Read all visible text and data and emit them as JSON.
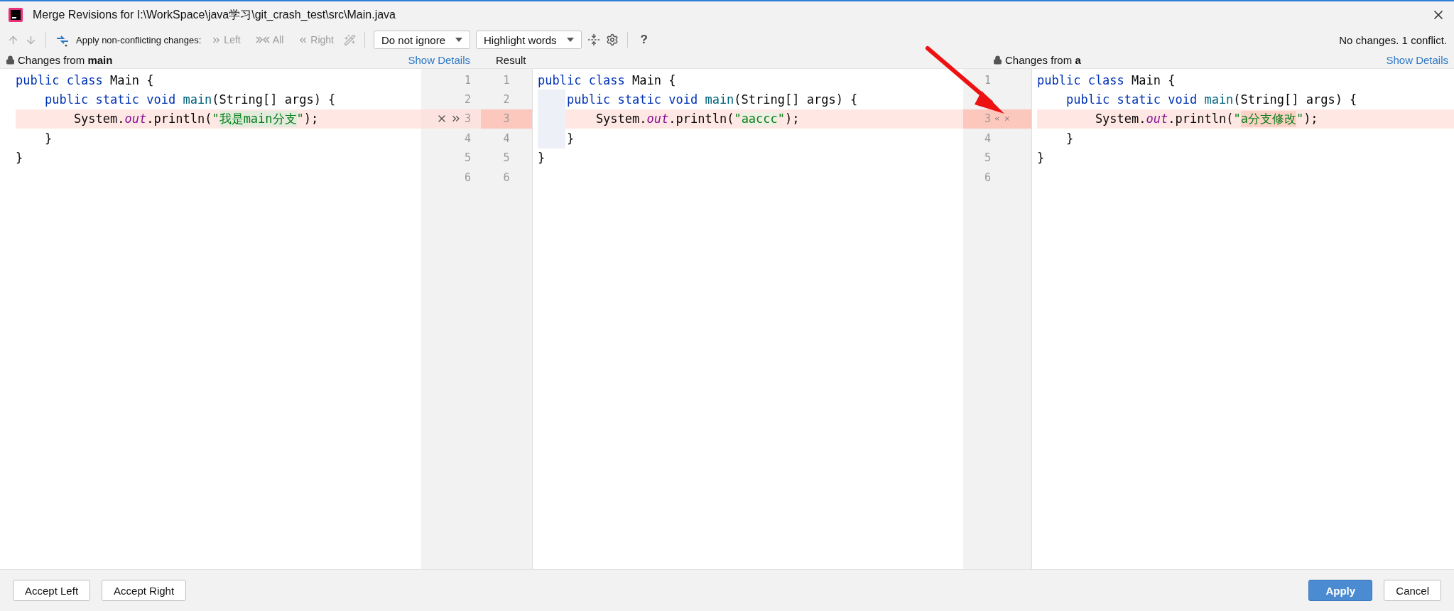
{
  "window": {
    "title": "Merge Revisions for I:\\WorkSpace\\java学习\\git_crash_test\\src\\Main.java"
  },
  "toolbar": {
    "nav": [
      {
        "kind": "up",
        "disabled": true
      },
      {
        "kind": "down",
        "disabled": true
      }
    ],
    "apply_label": "Apply non-conflicting changes:",
    "apply_buttons": [
      {
        "kind": "left",
        "label": "Left",
        "disabled": true
      },
      {
        "kind": "all",
        "label": "All",
        "disabled": true
      },
      {
        "kind": "right",
        "label": "Right",
        "disabled": true
      }
    ],
    "dropdowns": [
      {
        "value": "Do not ignore"
      },
      {
        "value": "Highlight words"
      }
    ],
    "help": "?",
    "status": "No changes. 1 conflict."
  },
  "panes": [
    {
      "kind": "left",
      "title": "Changes from **main**",
      "locked": true,
      "show_details": "Show Details",
      "lines": [
        {
          "number": "1",
          "conflict": false,
          "tokens": [
            {
              "kind": "kw",
              "text": "public class"
            },
            {
              "kind": "plain",
              "text": " Main {"
            }
          ]
        },
        {
          "number": "2",
          "conflict": false,
          "tokens": [
            {
              "kind": "kw",
              "text": "    public static void"
            },
            {
              "kind": "fn",
              "text": " main"
            },
            {
              "kind": "plain",
              "text": "(String[] args) {"
            }
          ]
        },
        {
          "number": "3",
          "conflict": true,
          "tokens": [
            {
              "kind": "plain",
              "text": "        System."
            },
            {
              "kind": "field",
              "text": "out"
            },
            {
              "kind": "plain",
              "text": ".println("
            },
            {
              "kind": "str",
              "text": "\""
            },
            {
              "kind": "changed",
              "text": "我是main分支"
            },
            {
              "kind": "str",
              "text": "\""
            },
            {
              "kind": "plain",
              "text": ");"
            }
          ]
        },
        {
          "number": "4",
          "conflict": false,
          "tokens": [
            {
              "kind": "plain",
              "text": "    }"
            }
          ]
        },
        {
          "number": "5",
          "conflict": false,
          "tokens": [
            {
              "kind": "plain",
              "text": "}"
            }
          ]
        },
        {
          "number": "6",
          "conflict": false
        }
      ]
    },
    {
      "kind": "result",
      "title": "Result",
      "lines": [
        {
          "number": "1",
          "conflict": false,
          "tokens": [
            {
              "kind": "kw",
              "text": "public class"
            },
            {
              "kind": "plain",
              "text": " Main {"
            }
          ]
        },
        {
          "number": "2",
          "conflict": false,
          "tokens": [
            {
              "kind": "kw",
              "text": "    public static void"
            },
            {
              "kind": "fn",
              "text": " main"
            },
            {
              "kind": "plain",
              "text": "(String[] args) {"
            }
          ]
        },
        {
          "number": "3",
          "conflict": true,
          "tokens": [
            {
              "kind": "plain",
              "text": "        System."
            },
            {
              "kind": "field",
              "text": "out"
            },
            {
              "kind": "plain",
              "text": ".println("
            },
            {
              "kind": "str",
              "text": "\""
            },
            {
              "kind": "changed",
              "text": "aaccc"
            },
            {
              "kind": "str",
              "text": "\""
            },
            {
              "kind": "plain",
              "text": ");"
            }
          ]
        },
        {
          "number": "4",
          "conflict": false,
          "tokens": [
            {
              "kind": "plain",
              "text": "    }"
            }
          ]
        },
        {
          "number": "5",
          "conflict": false,
          "tokens": [
            {
              "kind": "plain",
              "text": "}"
            }
          ]
        },
        {
          "number": "6",
          "conflict": false
        }
      ]
    },
    {
      "kind": "right",
      "title": "Changes from **a**",
      "locked": true,
      "show_details": "Show Details",
      "lines": [
        {
          "number": "1",
          "conflict": false,
          "tokens": [
            {
              "kind": "kw",
              "text": "public class"
            },
            {
              "kind": "plain",
              "text": " Main {"
            }
          ]
        },
        {
          "conflict": false,
          "tokens": [
            {
              "kind": "kw",
              "text": "    public static void"
            },
            {
              "kind": "fn",
              "text": " main"
            },
            {
              "kind": "plain",
              "text": "(String[] args) {"
            }
          ]
        },
        {
          "number": "3",
          "conflict": true,
          "tokens": [
            {
              "kind": "plain",
              "text": "        System."
            },
            {
              "kind": "field",
              "text": "out"
            },
            {
              "kind": "plain",
              "text": ".println("
            },
            {
              "kind": "str",
              "text": "\""
            },
            {
              "kind": "changed",
              "text": "a分支修改"
            },
            {
              "kind": "str",
              "text": "\""
            },
            {
              "kind": "plain",
              "text": ");"
            }
          ]
        },
        {
          "number": "4",
          "conflict": false,
          "tokens": [
            {
              "kind": "plain",
              "text": "    }"
            }
          ]
        },
        {
          "number": "5",
          "conflict": false,
          "tokens": [
            {
              "kind": "plain",
              "text": "}"
            }
          ]
        },
        {
          "number": "6",
          "conflict": false
        }
      ]
    }
  ],
  "footer": {
    "left_buttons": [
      {
        "label": "Accept Left",
        "primary": false
      },
      {
        "label": "Accept Right",
        "primary": false
      }
    ],
    "right_buttons": [
      {
        "label": "Apply",
        "primary": true
      },
      {
        "label": "Cancel",
        "primary": false
      }
    ]
  }
}
